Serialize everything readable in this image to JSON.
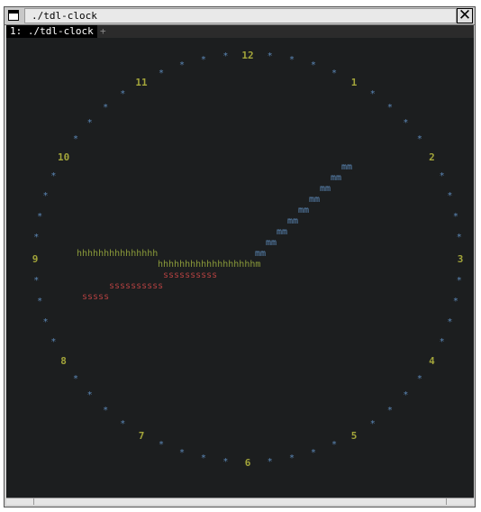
{
  "window": {
    "title": "./tdl-clock",
    "close_glyph": "✕"
  },
  "tabs": {
    "active_label": "1: ./tdl-clock",
    "new_tab": "+"
  },
  "clock": {
    "colors": {
      "ticks": "#5c88b8",
      "numbers": "#a3a53a",
      "hour_hand": "#8a9a3a",
      "minute_hand": "#5c88b8",
      "second_hand": "#b04040",
      "background": "#1c1e1f"
    },
    "numbers": [
      "12",
      "1",
      "2",
      "3",
      "4",
      "5",
      "6",
      "7",
      "8",
      "9",
      "10",
      "11"
    ],
    "tick_glyph": "*",
    "hands": {
      "hour": [
        "hhhhhhhhhhhhhhh",
        "hhhhhhhhhhhhhhhhhhm"
      ],
      "minute": [
        "mm",
        "mm",
        "mm",
        "mm",
        "mm",
        "mm",
        "mm",
        "mm",
        "mm"
      ],
      "second": [
        "ssssssssss",
        "ssssssssss",
        "sssss"
      ]
    }
  }
}
